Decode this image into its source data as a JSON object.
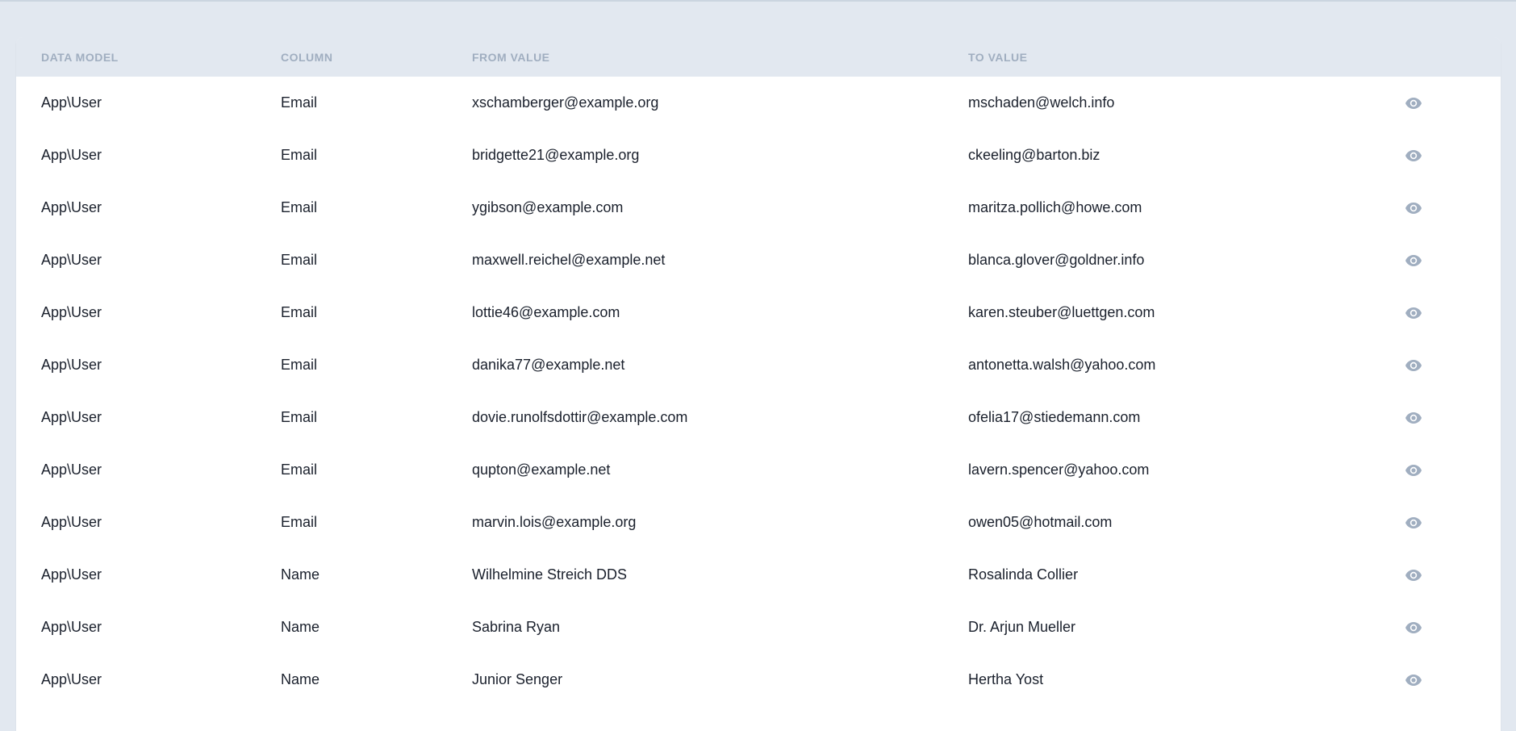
{
  "table": {
    "headers": {
      "data_model": "Data Model",
      "column": "Column",
      "from_value": "From Value",
      "to_value": "To Value"
    },
    "rows": [
      {
        "model": "App\\User",
        "column": "Email",
        "from": "xschamberger@example.org",
        "to": "mschaden@welch.info"
      },
      {
        "model": "App\\User",
        "column": "Email",
        "from": "bridgette21@example.org",
        "to": "ckeeling@barton.biz"
      },
      {
        "model": "App\\User",
        "column": "Email",
        "from": "ygibson@example.com",
        "to": "maritza.pollich@howe.com"
      },
      {
        "model": "App\\User",
        "column": "Email",
        "from": "maxwell.reichel@example.net",
        "to": "blanca.glover@goldner.info"
      },
      {
        "model": "App\\User",
        "column": "Email",
        "from": "lottie46@example.com",
        "to": "karen.steuber@luettgen.com"
      },
      {
        "model": "App\\User",
        "column": "Email",
        "from": "danika77@example.net",
        "to": "antonetta.walsh@yahoo.com"
      },
      {
        "model": "App\\User",
        "column": "Email",
        "from": "dovie.runolfsdottir@example.com",
        "to": "ofelia17@stiedemann.com"
      },
      {
        "model": "App\\User",
        "column": "Email",
        "from": "qupton@example.net",
        "to": "lavern.spencer@yahoo.com"
      },
      {
        "model": "App\\User",
        "column": "Email",
        "from": "marvin.lois@example.org",
        "to": "owen05@hotmail.com"
      },
      {
        "model": "App\\User",
        "column": "Name",
        "from": "Wilhelmine Streich DDS",
        "to": "Rosalinda Collier"
      },
      {
        "model": "App\\User",
        "column": "Name",
        "from": "Sabrina Ryan",
        "to": "Dr. Arjun Mueller"
      },
      {
        "model": "App\\User",
        "column": "Name",
        "from": "Junior Senger",
        "to": "Hertha Yost"
      }
    ],
    "row_action_icon": "eye-icon"
  },
  "colors": {
    "page_background": "#e2e8f0",
    "header_text": "#a0aec0",
    "cell_text": "#1a202c",
    "icon": "#a0aec0"
  }
}
